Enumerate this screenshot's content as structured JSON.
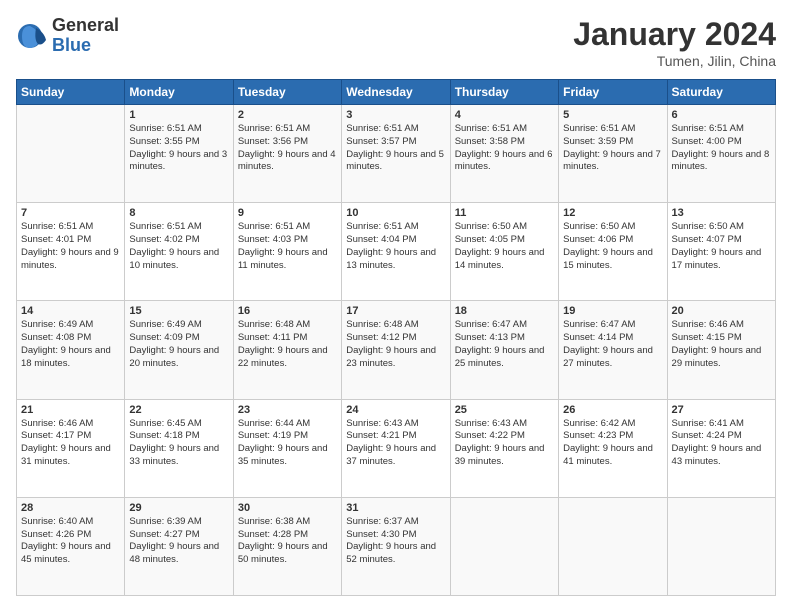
{
  "logo": {
    "general": "General",
    "blue": "Blue"
  },
  "title": "January 2024",
  "subtitle": "Tumen, Jilin, China",
  "header_days": [
    "Sunday",
    "Monday",
    "Tuesday",
    "Wednesday",
    "Thursday",
    "Friday",
    "Saturday"
  ],
  "weeks": [
    [
      {
        "day": "",
        "sunrise": "",
        "sunset": "",
        "daylight": ""
      },
      {
        "day": "1",
        "sunrise": "Sunrise: 6:51 AM",
        "sunset": "Sunset: 3:55 PM",
        "daylight": "Daylight: 9 hours and 3 minutes."
      },
      {
        "day": "2",
        "sunrise": "Sunrise: 6:51 AM",
        "sunset": "Sunset: 3:56 PM",
        "daylight": "Daylight: 9 hours and 4 minutes."
      },
      {
        "day": "3",
        "sunrise": "Sunrise: 6:51 AM",
        "sunset": "Sunset: 3:57 PM",
        "daylight": "Daylight: 9 hours and 5 minutes."
      },
      {
        "day": "4",
        "sunrise": "Sunrise: 6:51 AM",
        "sunset": "Sunset: 3:58 PM",
        "daylight": "Daylight: 9 hours and 6 minutes."
      },
      {
        "day": "5",
        "sunrise": "Sunrise: 6:51 AM",
        "sunset": "Sunset: 3:59 PM",
        "daylight": "Daylight: 9 hours and 7 minutes."
      },
      {
        "day": "6",
        "sunrise": "Sunrise: 6:51 AM",
        "sunset": "Sunset: 4:00 PM",
        "daylight": "Daylight: 9 hours and 8 minutes."
      }
    ],
    [
      {
        "day": "7",
        "sunrise": "Sunrise: 6:51 AM",
        "sunset": "Sunset: 4:01 PM",
        "daylight": "Daylight: 9 hours and 9 minutes."
      },
      {
        "day": "8",
        "sunrise": "Sunrise: 6:51 AM",
        "sunset": "Sunset: 4:02 PM",
        "daylight": "Daylight: 9 hours and 10 minutes."
      },
      {
        "day": "9",
        "sunrise": "Sunrise: 6:51 AM",
        "sunset": "Sunset: 4:03 PM",
        "daylight": "Daylight: 9 hours and 11 minutes."
      },
      {
        "day": "10",
        "sunrise": "Sunrise: 6:51 AM",
        "sunset": "Sunset: 4:04 PM",
        "daylight": "Daylight: 9 hours and 13 minutes."
      },
      {
        "day": "11",
        "sunrise": "Sunrise: 6:50 AM",
        "sunset": "Sunset: 4:05 PM",
        "daylight": "Daylight: 9 hours and 14 minutes."
      },
      {
        "day": "12",
        "sunrise": "Sunrise: 6:50 AM",
        "sunset": "Sunset: 4:06 PM",
        "daylight": "Daylight: 9 hours and 15 minutes."
      },
      {
        "day": "13",
        "sunrise": "Sunrise: 6:50 AM",
        "sunset": "Sunset: 4:07 PM",
        "daylight": "Daylight: 9 hours and 17 minutes."
      }
    ],
    [
      {
        "day": "14",
        "sunrise": "Sunrise: 6:49 AM",
        "sunset": "Sunset: 4:08 PM",
        "daylight": "Daylight: 9 hours and 18 minutes."
      },
      {
        "day": "15",
        "sunrise": "Sunrise: 6:49 AM",
        "sunset": "Sunset: 4:09 PM",
        "daylight": "Daylight: 9 hours and 20 minutes."
      },
      {
        "day": "16",
        "sunrise": "Sunrise: 6:48 AM",
        "sunset": "Sunset: 4:11 PM",
        "daylight": "Daylight: 9 hours and 22 minutes."
      },
      {
        "day": "17",
        "sunrise": "Sunrise: 6:48 AM",
        "sunset": "Sunset: 4:12 PM",
        "daylight": "Daylight: 9 hours and 23 minutes."
      },
      {
        "day": "18",
        "sunrise": "Sunrise: 6:47 AM",
        "sunset": "Sunset: 4:13 PM",
        "daylight": "Daylight: 9 hours and 25 minutes."
      },
      {
        "day": "19",
        "sunrise": "Sunrise: 6:47 AM",
        "sunset": "Sunset: 4:14 PM",
        "daylight": "Daylight: 9 hours and 27 minutes."
      },
      {
        "day": "20",
        "sunrise": "Sunrise: 6:46 AM",
        "sunset": "Sunset: 4:15 PM",
        "daylight": "Daylight: 9 hours and 29 minutes."
      }
    ],
    [
      {
        "day": "21",
        "sunrise": "Sunrise: 6:46 AM",
        "sunset": "Sunset: 4:17 PM",
        "daylight": "Daylight: 9 hours and 31 minutes."
      },
      {
        "day": "22",
        "sunrise": "Sunrise: 6:45 AM",
        "sunset": "Sunset: 4:18 PM",
        "daylight": "Daylight: 9 hours and 33 minutes."
      },
      {
        "day": "23",
        "sunrise": "Sunrise: 6:44 AM",
        "sunset": "Sunset: 4:19 PM",
        "daylight": "Daylight: 9 hours and 35 minutes."
      },
      {
        "day": "24",
        "sunrise": "Sunrise: 6:43 AM",
        "sunset": "Sunset: 4:21 PM",
        "daylight": "Daylight: 9 hours and 37 minutes."
      },
      {
        "day": "25",
        "sunrise": "Sunrise: 6:43 AM",
        "sunset": "Sunset: 4:22 PM",
        "daylight": "Daylight: 9 hours and 39 minutes."
      },
      {
        "day": "26",
        "sunrise": "Sunrise: 6:42 AM",
        "sunset": "Sunset: 4:23 PM",
        "daylight": "Daylight: 9 hours and 41 minutes."
      },
      {
        "day": "27",
        "sunrise": "Sunrise: 6:41 AM",
        "sunset": "Sunset: 4:24 PM",
        "daylight": "Daylight: 9 hours and 43 minutes."
      }
    ],
    [
      {
        "day": "28",
        "sunrise": "Sunrise: 6:40 AM",
        "sunset": "Sunset: 4:26 PM",
        "daylight": "Daylight: 9 hours and 45 minutes."
      },
      {
        "day": "29",
        "sunrise": "Sunrise: 6:39 AM",
        "sunset": "Sunset: 4:27 PM",
        "daylight": "Daylight: 9 hours and 48 minutes."
      },
      {
        "day": "30",
        "sunrise": "Sunrise: 6:38 AM",
        "sunset": "Sunset: 4:28 PM",
        "daylight": "Daylight: 9 hours and 50 minutes."
      },
      {
        "day": "31",
        "sunrise": "Sunrise: 6:37 AM",
        "sunset": "Sunset: 4:30 PM",
        "daylight": "Daylight: 9 hours and 52 minutes."
      },
      {
        "day": "",
        "sunrise": "",
        "sunset": "",
        "daylight": ""
      },
      {
        "day": "",
        "sunrise": "",
        "sunset": "",
        "daylight": ""
      },
      {
        "day": "",
        "sunrise": "",
        "sunset": "",
        "daylight": ""
      }
    ]
  ]
}
